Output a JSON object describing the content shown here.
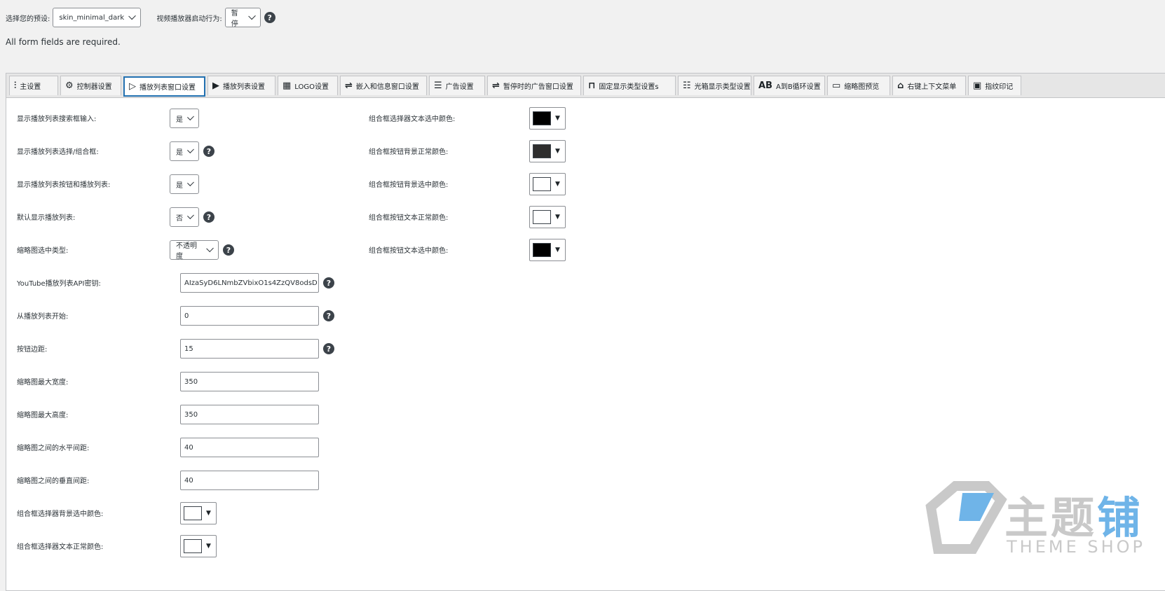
{
  "top": {
    "preset_label": "选择您的预设:",
    "preset_value": "skin_minimal_dark",
    "autoplay_label": "视频播放器启动行为:",
    "autoplay_value": "暂停",
    "required_text": "All form fields are required."
  },
  "tabs": [
    {
      "label": "主设置",
      "icon": "sliders-icon"
    },
    {
      "label": "控制器设置",
      "icon": "gear-icon"
    },
    {
      "label": "播放列表窗口设置",
      "icon": "playlist-window-icon"
    },
    {
      "label": "播放列表设置",
      "icon": "playlist-icon"
    },
    {
      "label": "LOGO设置",
      "icon": "logo-icon"
    },
    {
      "label": "嵌入和信息窗口设置",
      "icon": "embed-icon"
    },
    {
      "label": "广告设置",
      "icon": "ad-icon"
    },
    {
      "label": "暂停时的广告窗口设置",
      "icon": "pause-ad-icon"
    },
    {
      "label": "固定显示类型设置s",
      "icon": "sticky-icon"
    },
    {
      "label": "光箱显示类型设置",
      "icon": "lightbox-icon"
    },
    {
      "label": "A到B循环设置",
      "icon": "ab-icon"
    },
    {
      "label": "缩略图预览",
      "icon": "monitor-icon"
    },
    {
      "label": "右键上下文菜单",
      "icon": "mouse-icon"
    },
    {
      "label": "指纹印记",
      "icon": "fingerprint-icon"
    }
  ],
  "active_tab": "播放列表窗口设置",
  "left_fields": [
    {
      "label": "显示播放列表搜索框输入:",
      "type": "select",
      "value": "是",
      "help": false
    },
    {
      "label": "显示播放列表选择/组合框:",
      "type": "select",
      "value": "是",
      "help": true
    },
    {
      "label": "显示播放列表按钮和播放列表:",
      "type": "select",
      "value": "是",
      "help": false
    },
    {
      "label": "默认显示播放列表:",
      "type": "select",
      "value": "否",
      "help": true
    },
    {
      "label": "缩略图选中类型:",
      "type": "select",
      "value": "不透明度",
      "help": true
    },
    {
      "label": "YouTube播放列表API密钥:",
      "type": "text",
      "value": "AIzaSyD6LNmbZVbixO1s4ZzQV8odsD",
      "help": true
    },
    {
      "label": "从播放列表开始:",
      "type": "text",
      "value": "0",
      "help": true
    },
    {
      "label": "按钮边距:",
      "type": "text",
      "value": "15",
      "help": true
    },
    {
      "label": "缩略图最大宽度:",
      "type": "text",
      "value": "350",
      "help": false
    },
    {
      "label": "缩略图最大高度:",
      "type": "text",
      "value": "350",
      "help": false
    },
    {
      "label": "缩略图之间的水平间距:",
      "type": "text",
      "value": "40",
      "help": false
    },
    {
      "label": "缩略图之间的垂直间距:",
      "type": "text",
      "value": "40",
      "help": false
    },
    {
      "label": "组合框选择器背景选中颜色:",
      "type": "color",
      "value": "#ffffff",
      "help": false
    },
    {
      "label": "组合框选择器文本正常颜色:",
      "type": "color",
      "value": "#ffffff",
      "help": false
    }
  ],
  "right_fields": [
    {
      "label": "组合框选择器文本选中颜色:",
      "color": "#000000"
    },
    {
      "label": "组合框按钮背景正常颜色:",
      "color": "#2e2e2e"
    },
    {
      "label": "组合框按钮背景选中颜色:",
      "color": "#ffffff"
    },
    {
      "label": "组合框按钮文本正常颜色:",
      "color": "#ffffff"
    },
    {
      "label": "组合框按钮文本选中颜色:",
      "color": "#000000"
    }
  ],
  "watermark": {
    "title_gray": "主题",
    "title_blue": "铺",
    "sub": "THEME SHOP"
  }
}
